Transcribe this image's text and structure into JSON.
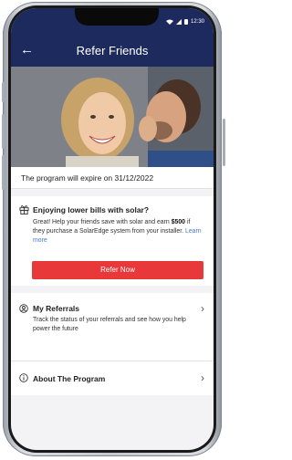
{
  "status_bar": {
    "time": "12:30",
    "icons": [
      "wifi-icon",
      "signal-icon",
      "battery-icon"
    ]
  },
  "header": {
    "back_icon": "arrow-left-icon",
    "title": "Refer Friends"
  },
  "hero": {
    "image": "photo of a man whispering to a smiling blonde woman"
  },
  "expiry_text": "The program will expire on 31/12/2022",
  "promo": {
    "icon": "gift-icon",
    "title": "Enjoying lower bills with solar?",
    "body_prefix": "Great! Help your friends save with solar and earn",
    "amount": "$500",
    "body_suffix": "if they purchase a SolarEdge system from your installer.",
    "learn_more": "Learn more",
    "button_label": "Refer Now"
  },
  "menu": {
    "items": [
      {
        "icon": "user-circle-icon",
        "title": "My Referrals",
        "description": "Track the status of your referrals and see how you help power the future"
      },
      {
        "icon": "info-icon",
        "title": "About The Program",
        "description": ""
      }
    ]
  },
  "colors": {
    "header_bg": "#1d2a5e",
    "accent_button": "#e8383a",
    "link": "#4a7ad0"
  }
}
